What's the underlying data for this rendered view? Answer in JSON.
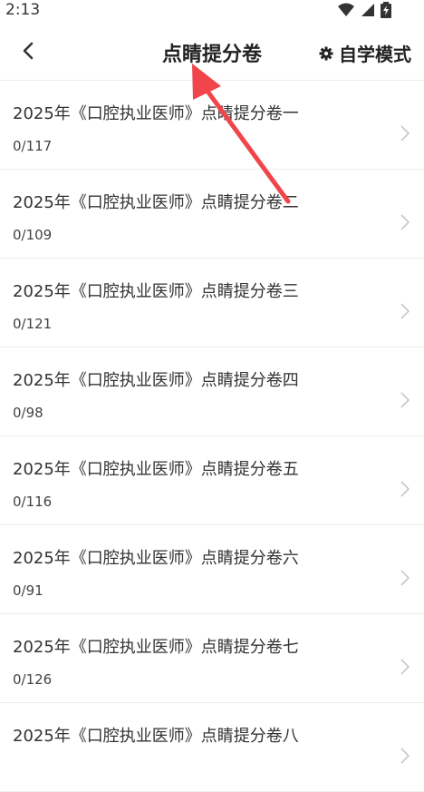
{
  "status_bar": {
    "time": "2:13"
  },
  "header": {
    "title": "点睛提分卷",
    "mode_label": "自学模式"
  },
  "items": [
    {
      "title": "2025年《口腔执业医师》点睛提分卷一",
      "progress": "0/117"
    },
    {
      "title": "2025年《口腔执业医师》点睛提分卷二",
      "progress": "0/109"
    },
    {
      "title": "2025年《口腔执业医师》点睛提分卷三",
      "progress": "0/121"
    },
    {
      "title": "2025年《口腔执业医师》点睛提分卷四",
      "progress": "0/98"
    },
    {
      "title": "2025年《口腔执业医师》点睛提分卷五",
      "progress": "0/116"
    },
    {
      "title": "2025年《口腔执业医师》点睛提分卷六",
      "progress": "0/91"
    },
    {
      "title": "2025年《口腔执业医师》点睛提分卷七",
      "progress": "0/126"
    },
    {
      "title": "2025年《口腔执业医师》点睛提分卷八",
      "progress": ""
    }
  ],
  "colors": {
    "annotation_arrow": "#f0454a",
    "divider": "#eeeeee"
  }
}
